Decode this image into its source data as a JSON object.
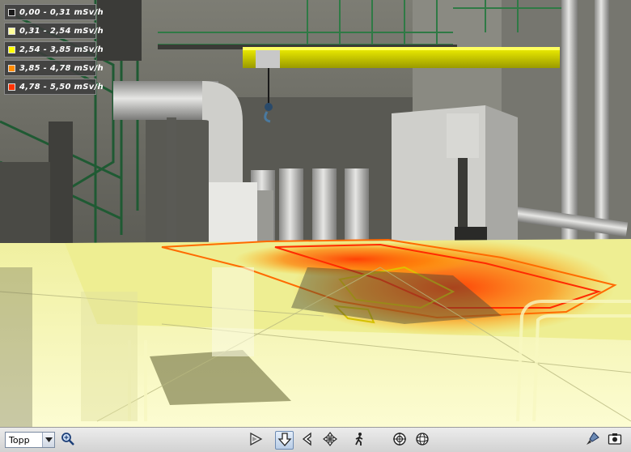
{
  "legend": {
    "items": [
      {
        "label": "0,00 - 0,31  mSv/h",
        "color": "#1a1a1a"
      },
      {
        "label": "0,31 - 2,54  mSv/h",
        "color": "#ffff99"
      },
      {
        "label": "2,54 - 3,85  mSv/h",
        "color": "#ffff00"
      },
      {
        "label": "3,85 - 4,78  mSv/h",
        "color": "#ff8c00"
      },
      {
        "label": "4,78 - 5,50  mSv/h",
        "color": "#ff3300"
      }
    ]
  },
  "toolbar": {
    "view_select": {
      "value": "Topp"
    },
    "buttons": [
      {
        "name": "zoom-icon",
        "active": false
      },
      {
        "name": "play-icon",
        "active": false
      },
      {
        "name": "navigate-icon",
        "active": true
      },
      {
        "name": "look-icon",
        "active": false
      },
      {
        "name": "pan-icon",
        "active": false
      },
      {
        "name": "walk-icon",
        "active": false
      },
      {
        "name": "target-icon",
        "active": false
      },
      {
        "name": "orbit-icon",
        "active": false
      },
      {
        "name": "paint-icon",
        "active": false
      },
      {
        "name": "camera-icon",
        "active": false
      }
    ]
  }
}
